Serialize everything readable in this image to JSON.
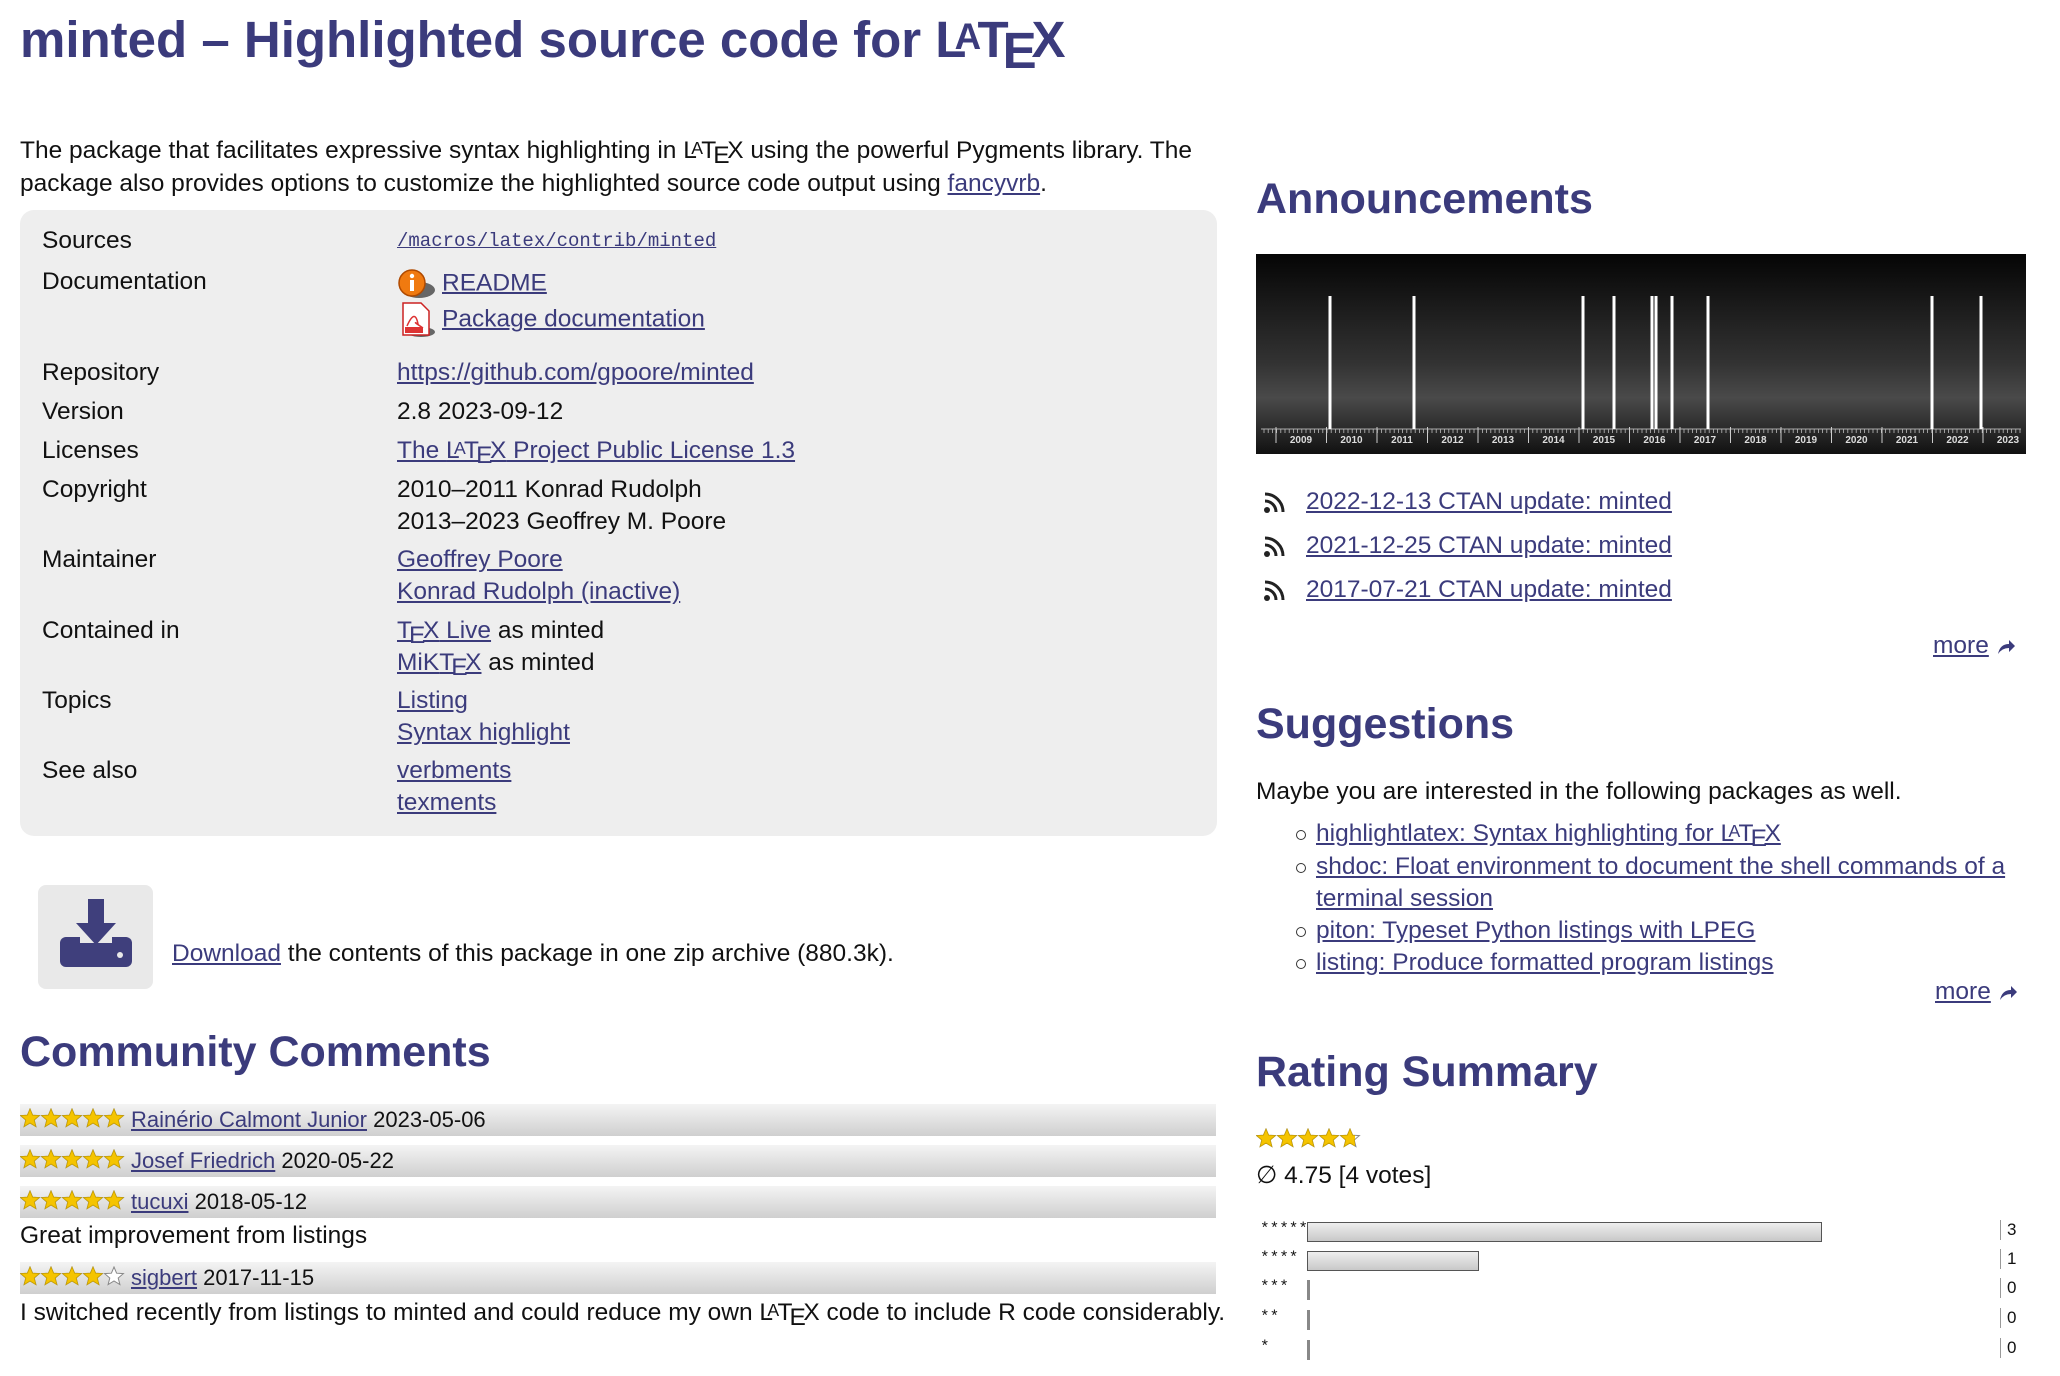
{
  "title": {
    "prefix": "minted – Highlighted source code for "
  },
  "intro": {
    "part1": "The package that facilitates expressive syntax highlighting in ",
    "part2": " using the powerful Pygments library. The package also provides options to customize the highlighted source code output using ",
    "link": "fancyvrb",
    "part3": "."
  },
  "info": {
    "sources": {
      "label": "Sources",
      "value": "/macros/latex/contrib/minted"
    },
    "documentation": {
      "label": "Documentation",
      "readme": "README",
      "package_doc": "Package documentation"
    },
    "repository": {
      "label": "Repository",
      "value": "https://github.com/gpoore/minted"
    },
    "version": {
      "label": "Version",
      "value": "2.8 2023-09-12"
    },
    "licenses": {
      "label": "Licenses",
      "prefix": "The ",
      "suffix": " Project Public License 1.3"
    },
    "copyright": {
      "label": "Copyright",
      "line1": "2010–2011 Konrad Rudolph",
      "line2": "2013–2023 Geoffrey M. Poore"
    },
    "maintainer": {
      "label": "Maintainer",
      "m1": "Geoffrey Poore",
      "m2": "Konrad Rudolph (inactive)"
    },
    "contained": {
      "label": "Contained in",
      "texlive_suffix": " Live",
      "texlive_as": " as minted",
      "miktex_prefix": "MiK",
      "miktex_as": " as minted"
    },
    "topics": {
      "label": "Topics",
      "t1": "Listing",
      "t2": "Syntax highlight"
    },
    "see_also": {
      "label": "See also",
      "s1": "verbments",
      "s2": "texments"
    }
  },
  "download": {
    "link": "Download",
    "text": " the contents of this package in one zip archive (880.3k)."
  },
  "comments": {
    "heading": "Community Comments",
    "items": [
      {
        "author": "Rainério Calmont Junior",
        "date": "2023-05-06",
        "stars": 5,
        "text": ""
      },
      {
        "author": "Josef Friedrich",
        "date": "2020-05-22",
        "stars": 5,
        "text": ""
      },
      {
        "author": "tucuxi",
        "date": "2018-05-12",
        "stars": 5,
        "text": "Great improvement from listings"
      },
      {
        "author": "sigbert",
        "date": "2017-11-15",
        "stars": 4,
        "text_part1": "I switched recently from listings to minted and could reduce my own ",
        "text_part2": " code to include R code considerably."
      }
    ]
  },
  "announcements": {
    "heading": "Announcements",
    "timeline_years": [
      "2009",
      "2010",
      "2011",
      "2012",
      "2013",
      "2014",
      "2015",
      "2016",
      "2017",
      "2018",
      "2019",
      "2020",
      "2021",
      "2022",
      "2023"
    ],
    "items": [
      {
        "label": "2022-12-13 CTAN update: minted"
      },
      {
        "label": "2021-12-25 CTAN update: minted"
      },
      {
        "label": "2017-07-21 CTAN update: minted"
      }
    ],
    "more": "more"
  },
  "suggestions": {
    "heading": "Suggestions",
    "intro": "Maybe you are interested in the following packages as well.",
    "items": [
      "highlightlatex: Syntax highlighting for ",
      "shdoc: Float environment to document the shell commands of a terminal session",
      "piton: Typeset Python listings with LPEG",
      "listing: Produce formatted program listings"
    ],
    "more": "more"
  },
  "rating": {
    "heading": "Rating Summary",
    "average_text": "∅ 4.75 [4 votes]",
    "average": 4.75,
    "rows": [
      {
        "label": "*****",
        "count": "3",
        "fraction": 0.75
      },
      {
        "label": "****",
        "count": "1",
        "fraction": 0.25
      },
      {
        "label": "***",
        "count": "0",
        "fraction": 0
      },
      {
        "label": "**",
        "count": "0",
        "fraction": 0
      },
      {
        "label": "*",
        "count": "0",
        "fraction": 0
      }
    ]
  },
  "colors": {
    "accent": "#3b3b7c",
    "star": "#f5c400",
    "box": "#eeeeee"
  }
}
